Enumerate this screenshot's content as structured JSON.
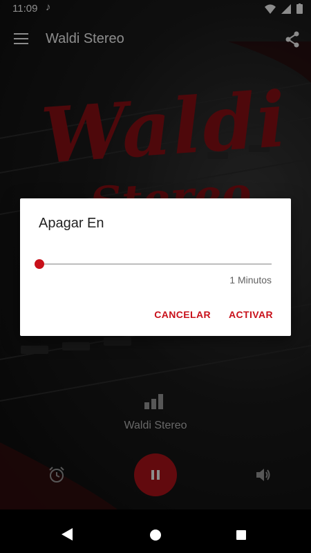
{
  "status_bar": {
    "time": "11:09",
    "music_icon": "music-note-icon",
    "icons": [
      "wifi-icon",
      "signal-icon",
      "battery-icon"
    ]
  },
  "app_bar": {
    "title": "Waldi Stereo",
    "menu_icon": "hamburger-menu-icon",
    "share_icon": "share-icon"
  },
  "background": {
    "logo_line1": "Waldi",
    "logo_line2": "Stereo",
    "logo_color": "#b3131b"
  },
  "dialog": {
    "title": "Apagar En",
    "slider_value_fraction": 0.0,
    "minutes_label": "1 Minutos",
    "cancel_label": "CANCELAR",
    "activate_label": "ACTIVAR",
    "accent_color": "#c8101a"
  },
  "player": {
    "station_name": "Waldi Stereo",
    "eq_icon": "equalizer-icon",
    "alarm_icon": "alarm-clock-icon",
    "pause_icon": "pause-icon",
    "volume_icon": "volume-icon",
    "play_button_color": "#b3131b"
  },
  "nav_bar": {
    "icons": [
      "back-icon",
      "home-icon",
      "recents-icon"
    ]
  }
}
